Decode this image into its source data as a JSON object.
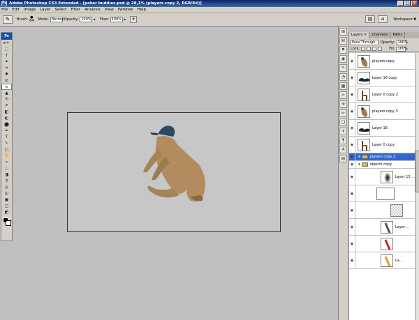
{
  "app": {
    "title": "Adobe Photoshop CS3 Extended - [poker buddies.psd @ 28,1% (players copy 2, RGB/8#)]",
    "logo": "Ps",
    "window_buttons": [
      "_",
      "□",
      "×"
    ]
  },
  "menu": [
    "File",
    "Edit",
    "Image",
    "Layer",
    "Select",
    "Filter",
    "Analysis",
    "View",
    "Window",
    "Help"
  ],
  "options": {
    "brush_label": "Brush:",
    "brush_size": "64",
    "mode_label": "Mode:",
    "mode_value": "Normal",
    "opacity_label": "Opacity:",
    "opacity_value": "100%",
    "flow_label": "Flow:",
    "flow_value": "100%",
    "workspace_label": "Workspace ▼"
  },
  "toolbox": {
    "header": "Ps",
    "tools": [
      "▸+",
      "⬚",
      "ℓ",
      "✦",
      "⌗",
      "✚",
      "⊘",
      "✎",
      "▲",
      "⟲",
      "✐",
      "◧",
      "◐",
      "⬤",
      "✒",
      "T",
      "↖",
      "□",
      "✋",
      "⌕",
      "◌",
      "◨",
      "⚲",
      "◎",
      "◫",
      "▣",
      "□",
      "◩"
    ],
    "active_index": 7
  },
  "dock_icons": [
    "⊞",
    "⌘",
    "⚑",
    "◉",
    "✎",
    "◔",
    "▦",
    "✂",
    "✢",
    "✏",
    "❑",
    "✈",
    "¶",
    "A",
    "▤"
  ],
  "layers_panel": {
    "tabs": [
      "Layers ×",
      "Channels",
      "Paths"
    ],
    "blend_mode": "Pass Through",
    "opacity_label": "Opacity:",
    "opacity_value": "100%",
    "lock_label": "Lock:",
    "fill_label": "Fill:",
    "fill_value": "100%",
    "layers": [
      {
        "name": "players copy",
        "type": "players"
      },
      {
        "name": "Layer 16 copy",
        "type": "shadow"
      },
      {
        "name": "Layer 0 copy 2",
        "type": "chair"
      },
      {
        "name": "players copy 3",
        "type": "players"
      },
      {
        "name": "Layer 16",
        "type": "shadow"
      },
      {
        "name": "Layer 0 copy",
        "type": "chair"
      },
      {
        "name": "players copy 2",
        "type": "group-selected"
      },
      {
        "name": "objects copy",
        "type": "group"
      },
      {
        "name": "Layer 15 ...",
        "type": "gradient"
      },
      {
        "name": "",
        "type": "mask"
      },
      {
        "name": "",
        "type": "checker"
      },
      {
        "name": "Layer ...",
        "type": "gray"
      },
      {
        "name": "",
        "type": "red"
      },
      {
        "name": "La...",
        "type": "yellow"
      }
    ]
  }
}
